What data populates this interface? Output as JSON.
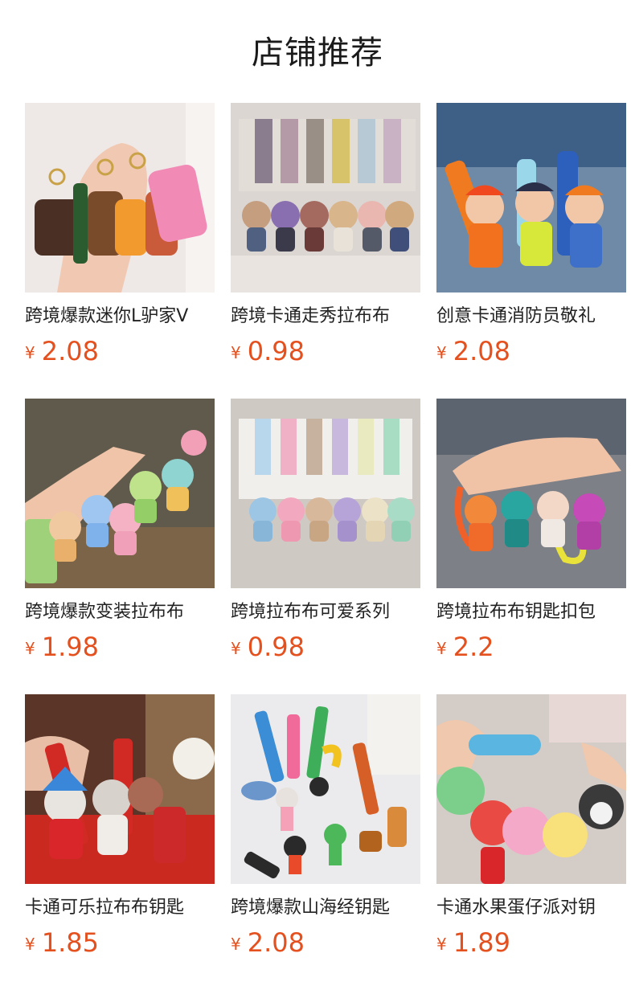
{
  "page": {
    "title": "店铺推荐"
  },
  "products": [
    {
      "name": "跨境爆款迷你L驴家V",
      "currency": "¥",
      "price": "2.08",
      "image": "keychain-bags-photo",
      "bg": "#ece6e6"
    },
    {
      "name": "跨境卡通走秀拉布布",
      "currency": "¥",
      "price": "0.98",
      "image": "keychain-labubu-display-photo",
      "bg": "#d9d3cf"
    },
    {
      "name": "创意卡通消防员敬礼",
      "currency": "¥",
      "price": "2.08",
      "image": "keychain-fireman-photo",
      "bg": "#7f93a8"
    },
    {
      "name": "跨境爆款变装拉布布",
      "currency": "¥",
      "price": "1.98",
      "image": "keychain-costume-labubu-photo",
      "bg": "#6f6654"
    },
    {
      "name": "跨境拉布布可爱系列",
      "currency": "¥",
      "price": "0.98",
      "image": "keychain-cute-labubu-photo",
      "bg": "#c9c2bd"
    },
    {
      "name": "跨境拉布布钥匙扣包",
      "currency": "¥",
      "price": "2.2",
      "image": "keychain-labubu-hoodie-photo",
      "bg": "#7c7f88"
    },
    {
      "name": "卡通可乐拉布布钥匙",
      "currency": "¥",
      "price": "1.85",
      "image": "keychain-cola-labubu-photo",
      "bg": "#6a3b30"
    },
    {
      "name": "跨境爆款山海经钥匙",
      "currency": "¥",
      "price": "2.08",
      "image": "keychain-shanhaijing-photo",
      "bg": "#e8e8ea"
    },
    {
      "name": "卡通水果蛋仔派对钥",
      "currency": "¥",
      "price": "1.89",
      "image": "keychain-eggy-party-photo",
      "bg": "#cfc7c2"
    }
  ]
}
